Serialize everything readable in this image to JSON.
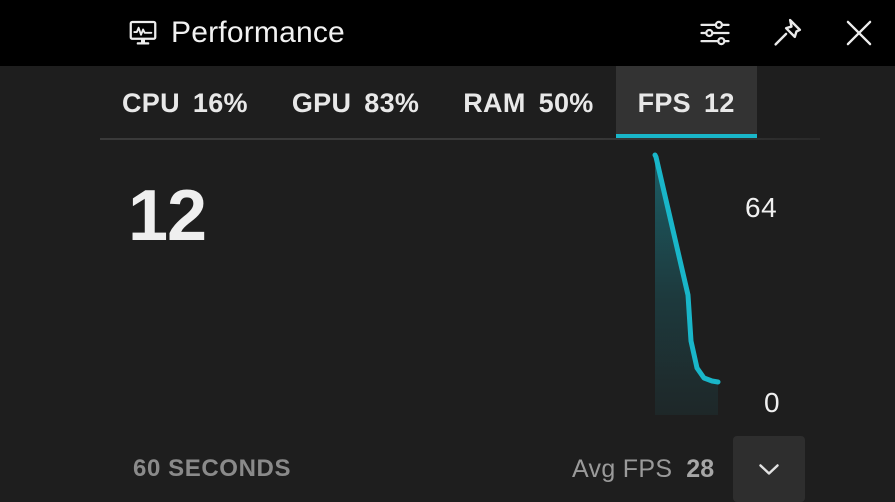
{
  "window": {
    "title": "Performance",
    "icon": "performance-monitor-icon",
    "background": "#1e1e1e",
    "titlebar_background": "#000000",
    "actions": [
      {
        "name": "settings-sliders-icon",
        "label": "Settings"
      },
      {
        "name": "pin-icon",
        "label": "Pin"
      },
      {
        "name": "close-icon",
        "label": "Close"
      }
    ]
  },
  "tabs": [
    {
      "id": "cpu",
      "label": "CPU",
      "value": "16%",
      "active": false
    },
    {
      "id": "gpu",
      "label": "GPU",
      "value": "83%",
      "active": false
    },
    {
      "id": "ram",
      "label": "RAM",
      "value": "50%",
      "active": false
    },
    {
      "id": "fps",
      "label": "FPS",
      "value": "12",
      "active": true
    }
  ],
  "accent_color": "#19b6c9",
  "detail": {
    "current_value": "12",
    "axis_max": "64",
    "axis_min": "0",
    "time_range": "60 SECONDS",
    "avg_label": "Avg FPS",
    "avg_value": "28",
    "expand_icon": "chevron-down-icon"
  },
  "chart_data": {
    "type": "area",
    "title": "FPS",
    "xlabel": "60 SECONDS",
    "ylabel": "FPS",
    "ylim": [
      0,
      64
    ],
    "xlim": [
      0,
      60
    ],
    "grid": false,
    "legend": null,
    "line_color": "#19b6c9",
    "fill_color": "#19b6c9",
    "series": [
      {
        "name": "FPS",
        "x": [
          54,
          55,
          56,
          56.6,
          57.2,
          57.8,
          58.4,
          59,
          60
        ],
        "values": [
          64,
          64,
          60,
          46,
          30,
          19,
          14,
          12,
          12
        ]
      }
    ]
  }
}
